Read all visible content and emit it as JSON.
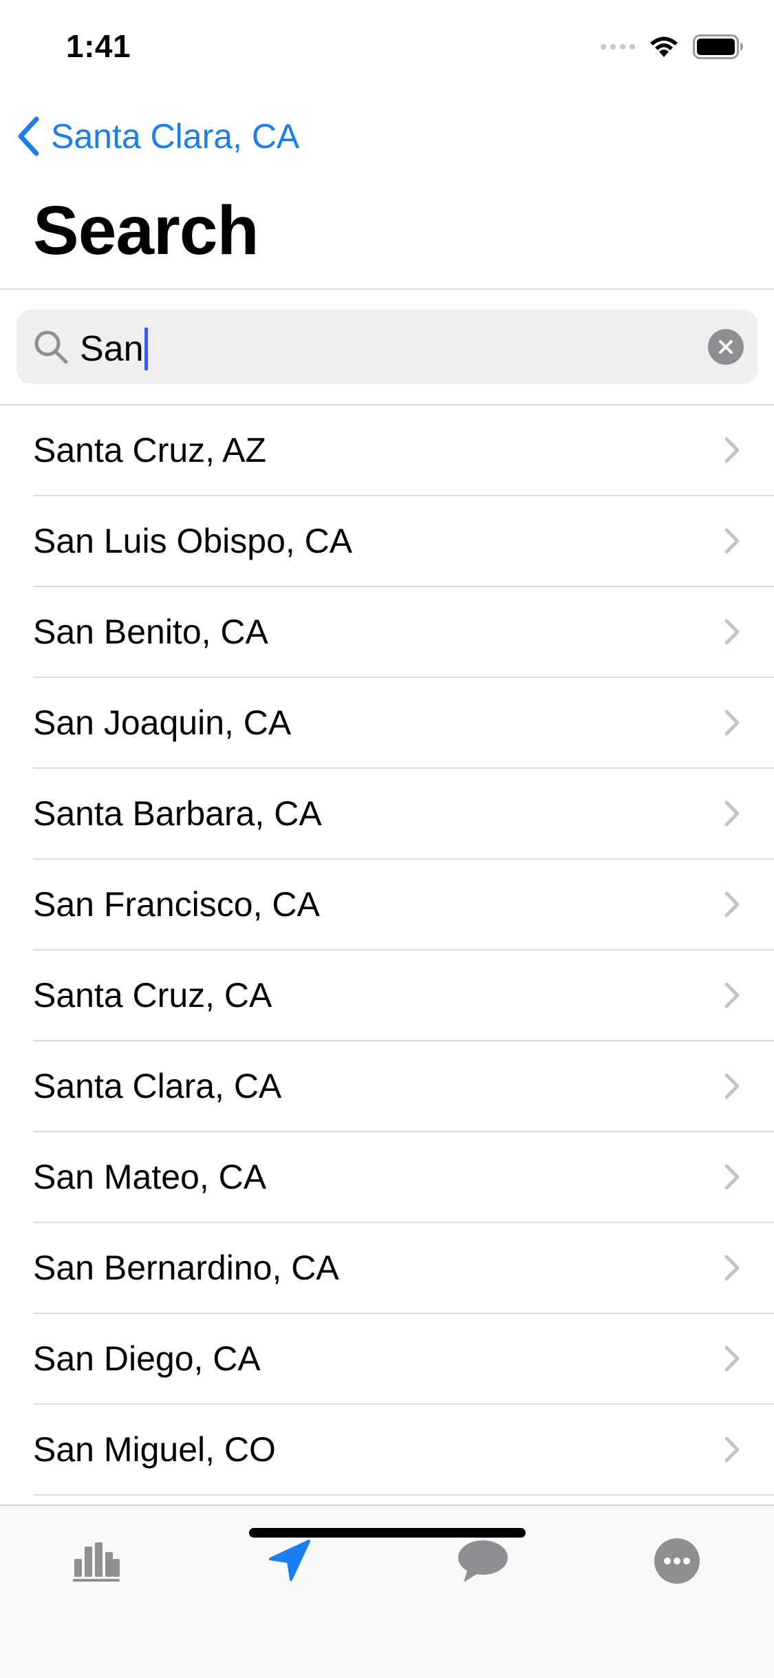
{
  "status_bar": {
    "time": "1:41",
    "icons": [
      "signal-dots",
      "wifi-icon",
      "battery-icon"
    ]
  },
  "nav": {
    "back_label": "Santa Clara, CA",
    "title": "Search"
  },
  "search": {
    "value": "San",
    "icon": "search-icon",
    "clear_icon": "clear-icon"
  },
  "results": [
    "Santa Cruz, AZ",
    "San Luis Obispo, CA",
    "San Benito, CA",
    "San Joaquin, CA",
    "Santa Barbara, CA",
    "San Francisco, CA",
    "Santa Cruz, CA",
    "Santa Clara, CA",
    "San Mateo, CA",
    "San Bernardino, CA",
    "San Diego, CA",
    "San Miguel, CO"
  ],
  "tab_bar": {
    "tabs": [
      {
        "icon": "bar-chart-icon",
        "selected": false
      },
      {
        "icon": "location-arrow-icon",
        "selected": true
      },
      {
        "icon": "chat-bubble-icon",
        "selected": false
      },
      {
        "icon": "more-icon",
        "selected": false
      }
    ]
  },
  "colors": {
    "accent": "#1a7df1",
    "inactive_icon": "#8e8e93",
    "search_background": "#efeff0",
    "separator": "#dcdcde",
    "caret": "#3d5bf5"
  }
}
